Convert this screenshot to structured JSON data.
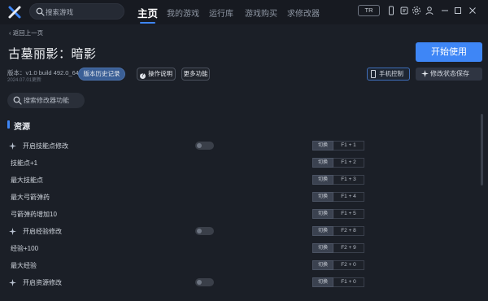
{
  "search": {
    "placeholder": "搜索游戏"
  },
  "nav": [
    {
      "label": "主页",
      "active": true
    },
    {
      "label": "我的游戏"
    },
    {
      "label": "运行库"
    },
    {
      "label": "游戏购买"
    },
    {
      "label": "求修改器"
    }
  ],
  "top_right": {
    "badge": "TR"
  },
  "header": {
    "back": "返回上一页",
    "title": "古墓丽影：暗影",
    "version": "版本：v1.0 build 492.0_64",
    "date": "2024.07.01更新",
    "history_btn": "版本历史记录",
    "guide_btn": "操作说明",
    "more_btn": "更多功能",
    "start_btn": "开始使用",
    "phone_btn": "手机控制",
    "save_btn": "修改状态保存"
  },
  "modsearch": {
    "placeholder": "搜索修改器功能"
  },
  "section_title": "资源",
  "switch_label": "切换",
  "rows": [
    {
      "label": "开启技能点修改",
      "hotkey": "F1 + 1",
      "toggle": true,
      "spark": true
    },
    {
      "label": "技能点+1",
      "hotkey": "F1 + 2",
      "toggle": false,
      "spark": false
    },
    {
      "label": "最大技能点",
      "hotkey": "F1 + 3",
      "toggle": false,
      "spark": false
    },
    {
      "label": "最大弓箭弹药",
      "hotkey": "F1 + 4",
      "toggle": false,
      "spark": false
    },
    {
      "label": "弓箭弹药增加10",
      "hotkey": "F1 + 5",
      "toggle": false,
      "spark": false
    },
    {
      "label": "开启经验修改",
      "hotkey": "F2 + 8",
      "toggle": true,
      "spark": true
    },
    {
      "label": "经验+100",
      "hotkey": "F2 + 9",
      "toggle": false,
      "spark": false
    },
    {
      "label": "最大经验",
      "hotkey": "F2 + 0",
      "toggle": false,
      "spark": false
    },
    {
      "label": "开启资源修改",
      "hotkey": "F1 + 0",
      "toggle": true,
      "spark": true
    }
  ],
  "colors": {
    "accent": "#3e86f6",
    "bg": "#1b1f27",
    "topbar": "#171a21"
  }
}
